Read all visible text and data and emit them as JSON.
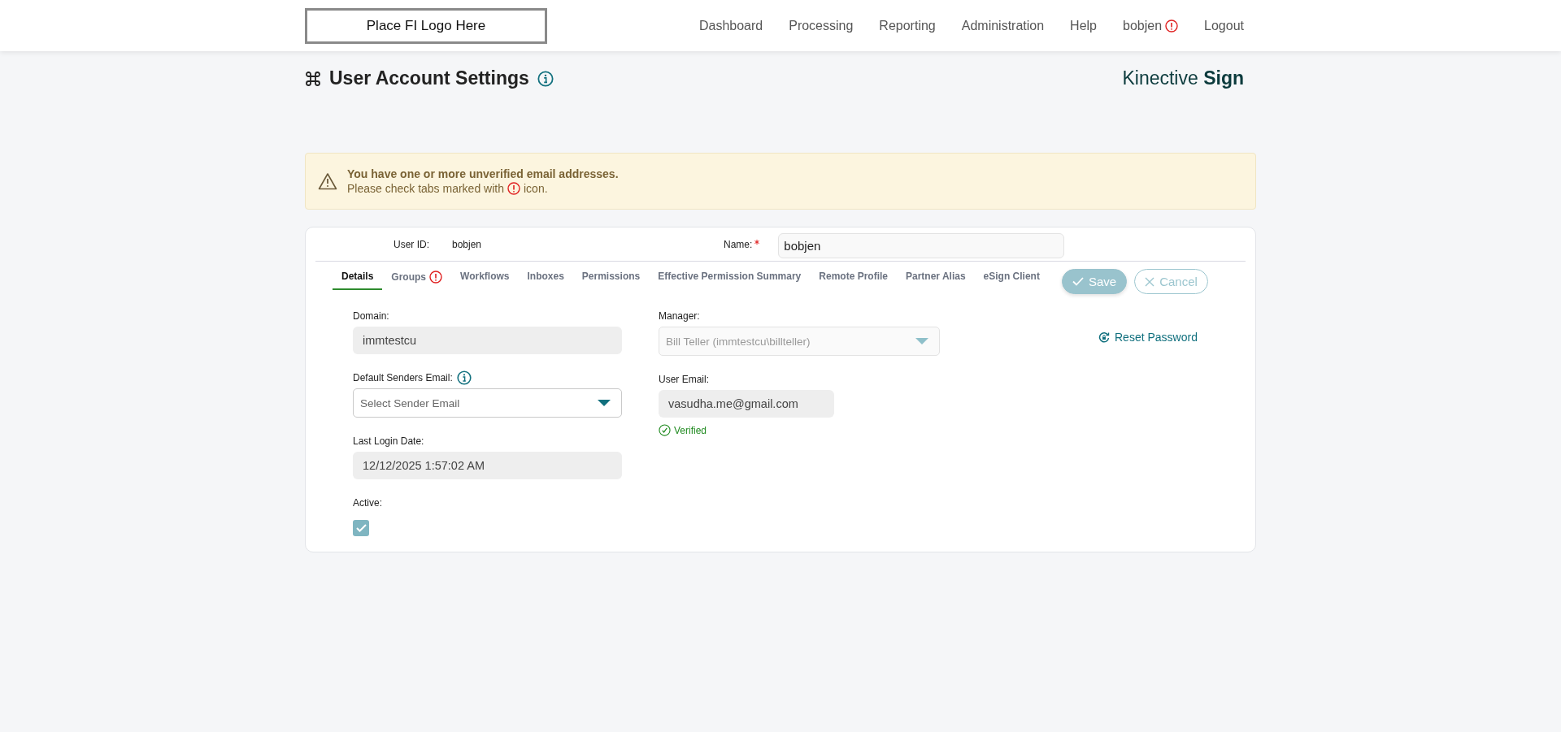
{
  "header": {
    "logo_text": "Place FI Logo Here",
    "nav": [
      {
        "label": "Dashboard",
        "alert": false
      },
      {
        "label": "Processing",
        "alert": false
      },
      {
        "label": "Reporting",
        "alert": false
      },
      {
        "label": "Administration",
        "alert": false
      },
      {
        "label": "Help",
        "alert": false
      },
      {
        "label": "bobjen",
        "alert": true
      },
      {
        "label": "Logout",
        "alert": false
      }
    ]
  },
  "page": {
    "title": "User Account Settings",
    "brand": "Kinective **Sign**"
  },
  "alert": {
    "title": "You have one or more unverified email addresses.",
    "message_before": "Please check tabs marked with",
    "message_after": "icon."
  },
  "user": {
    "user_id_label": "User ID:",
    "user_id": "bobjen",
    "name_label": "Name:",
    "name_required": true,
    "name_value": "bobjen"
  },
  "tabs": [
    {
      "label": "Details",
      "selected": true,
      "alert": false
    },
    {
      "label": "Groups",
      "selected": false,
      "alert": true
    },
    {
      "label": "Workflows",
      "selected": false,
      "alert": false
    },
    {
      "label": "Inboxes",
      "selected": false,
      "alert": false
    },
    {
      "label": "Permissions",
      "selected": false,
      "alert": false
    },
    {
      "label": "Effective Permission Summary",
      "selected": false,
      "alert": false
    },
    {
      "label": "Remote Profile",
      "selected": false,
      "alert": false
    },
    {
      "label": "Partner Alias",
      "selected": false,
      "alert": false
    },
    {
      "label": "eSign Client",
      "selected": false,
      "alert": false
    }
  ],
  "actions": [
    {
      "kind": "save",
      "label": "Save",
      "disabled": true
    },
    {
      "kind": "cancel",
      "label": "Cancel",
      "disabled": true
    }
  ],
  "left_fields": [
    {
      "kind": "text",
      "label": "Domain:",
      "value": "immtestcu",
      "info": false
    },
    {
      "kind": "select",
      "label": "Default Senders Email:",
      "placeholder": "Select Sender Email",
      "info": true,
      "disabled": false
    },
    {
      "kind": "text",
      "label": "Last Login Date:",
      "value": "12/12/2025 1:57:02 AM",
      "info": false
    },
    {
      "kind": "checkbox",
      "label": "Active:",
      "checked": true,
      "info": false
    }
  ],
  "right_fields": [
    {
      "kind": "select",
      "label": "Manager:",
      "value": "Bill Teller (immtestcu\\billteller)",
      "disabled": true,
      "info": false
    },
    {
      "kind": "email",
      "label": "User Email:",
      "value": "vasudha.me@gmail.com",
      "status": "Verified",
      "verified": true,
      "info": false
    }
  ],
  "reset_link": "Reset Password"
}
